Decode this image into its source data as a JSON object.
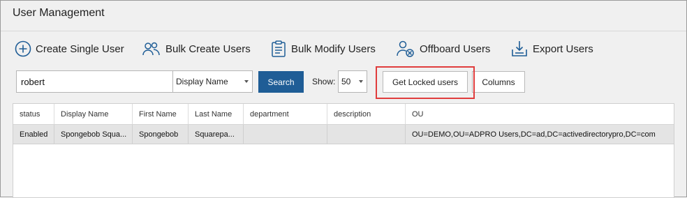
{
  "window": {
    "title": "User Management"
  },
  "toolbar": {
    "create_single_user": "Create Single User",
    "bulk_create_users": "Bulk Create Users",
    "bulk_modify_users": "Bulk Modify Users",
    "offboard_users": "Offboard Users",
    "export_users": "Export Users"
  },
  "search": {
    "value": "robert",
    "field": "Display Name",
    "button": "Search",
    "show_label": "Show:",
    "show_value": "50",
    "get_locked": "Get Locked users",
    "columns": "Columns"
  },
  "grid": {
    "columns": [
      "status",
      "Display Name",
      "First Name",
      "Last Name",
      "department",
      "description",
      "OU"
    ],
    "rows": [
      [
        "Enabled",
        "Spongebob Squa...",
        "Spongebob",
        "Squarepa...",
        "",
        "",
        "OU=DEMO,OU=ADPRO Users,DC=ad,DC=activedirectorypro,DC=com"
      ]
    ]
  },
  "colors": {
    "accent": "#1f5d96",
    "highlight": "#e03c3c",
    "icon": "#1f5d96"
  }
}
